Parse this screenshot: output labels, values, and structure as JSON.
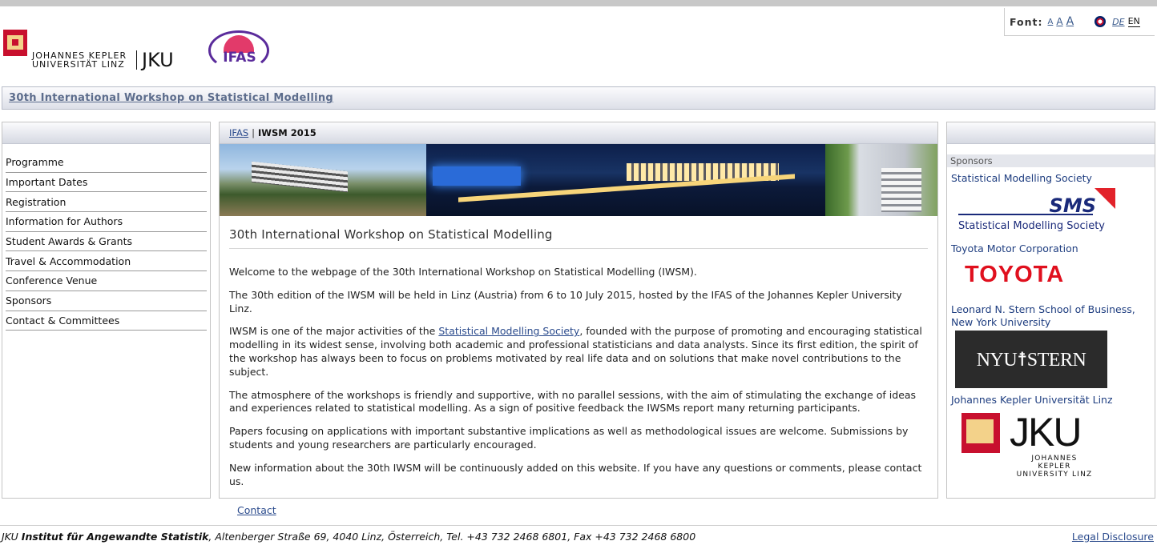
{
  "font_switcher": {
    "label": "Font:",
    "sizes": [
      "A",
      "A",
      "A"
    ],
    "languages": [
      "DE",
      "EN"
    ],
    "active_language": "EN"
  },
  "logos": {
    "jku_line1": "JOHANNES KEPLER",
    "jku_line2": "UNIVERSITÄT LINZ",
    "jku_short": "JKU",
    "ifas": "IFAS"
  },
  "site_title": "30th International Workshop on Statistical Modelling",
  "breadcrumb": {
    "home": "IFAS",
    "separator": "|",
    "current": "IWSM 2015"
  },
  "nav": {
    "items": [
      "Programme",
      "Important Dates",
      "Registration",
      "Information for Authors",
      "Student Awards & Grants",
      "Travel & Accommodation",
      "Conference Venue",
      "Sponsors",
      "Contact & Committees"
    ]
  },
  "main": {
    "heading": "30th International Workshop on Statistical Modelling",
    "p1": "Welcome to the webpage of the 30th International Workshop on Statistical Modelling (IWSM).",
    "p2": "The 30th edition of the IWSM will be held in Linz (Austria) from 6 to 10 July 2015, hosted by the IFAS of the Johannes Kepler University Linz.",
    "p3_before": "IWSM is one of the major activities of the ",
    "p3_link": "Statistical Modelling Society",
    "p3_after": ", founded with the purpose of promoting and encouraging statistical modelling in its widest sense, involving both academic and professional statisticians and data analysts. Since its first edition, the spirit of the workshop has always been to focus on problems motivated by real life data and on solutions that make novel contributions to the subject.",
    "p4": "The atmosphere of the workshops is friendly and supportive, with no parallel sessions, with the aim of stimulating the exchange of ideas and experiences related to statistical modelling. As a sign of positive feedback the IWSMs report many returning participants.",
    "p5": "Papers focusing on applications with important substantive implications as well as methodological issues are welcome. Submissions by students and young researchers are particularly encouraged.",
    "p6": "New information about the 30th IWSM will be continuously added on this website. If you have any questions or comments, please contact us."
  },
  "sponsors": {
    "heading": "Sponsors",
    "s1_name": "Statistical Modelling Society",
    "s1_logo_short": "SMS",
    "s1_logo_full": "Statistical Modelling Society",
    "s2_name": "Toyota Motor Corporation",
    "s2_logo": "TOYOTA",
    "s3_name": "Leonard N. Stern School of Business, New York University",
    "s3_logo": "NYU☨STERN",
    "s4_name": "Johannes Kepler Universität Linz",
    "s4_logo": "JKU",
    "s4_logo_line1": "JOHANNES KEPLER",
    "s4_logo_line2": "UNIVERSITY LINZ"
  },
  "footer": {
    "contact": "Contact",
    "prefix": "JKU ",
    "institute": "Institut für Angewandte Statistik",
    "address": ", Altenberger Straße 69, 4040 Linz, Österreich, Tel. +43 732 2468 6801, Fax +43 732 2468 6800",
    "legal": "Legal Disclosure"
  }
}
